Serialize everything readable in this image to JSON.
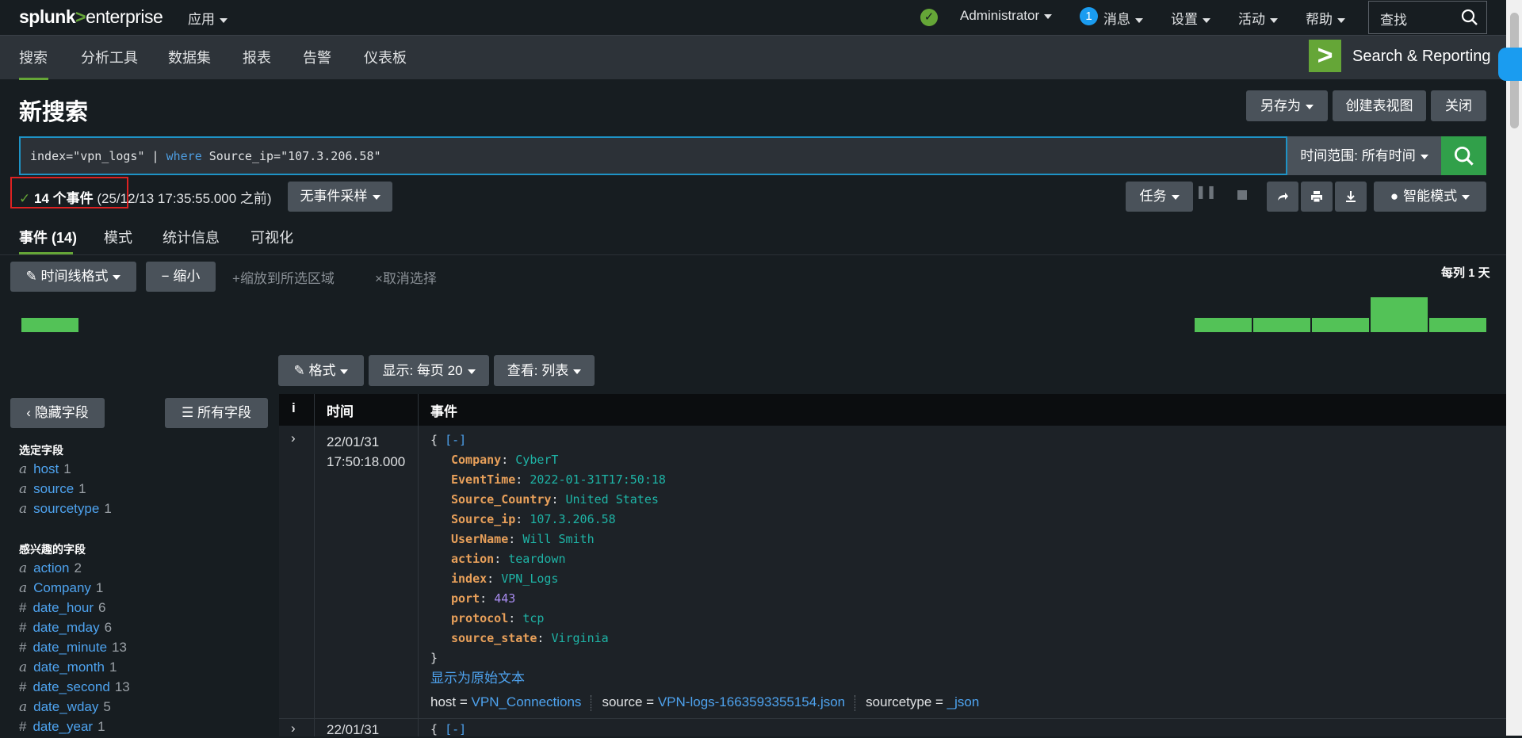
{
  "topbar": {
    "logo": {
      "splunk": "splunk",
      "gt": ">",
      "product": "enterprise"
    },
    "apps_label": "应用",
    "user_label": "Administrator",
    "messages_count": "1",
    "messages_label": "消息",
    "settings_label": "设置",
    "activity_label": "活动",
    "help_label": "帮助",
    "find_label": "查找"
  },
  "appnav": {
    "items": [
      "搜索",
      "分析工具",
      "数据集",
      "报表",
      "告警",
      "仪表板"
    ],
    "app_name": "Search & Reporting",
    "app_logo": ">"
  },
  "page": {
    "title": "新搜索",
    "save_as": "另存为",
    "create_table": "创建表视图",
    "close": "关闭"
  },
  "search": {
    "query_prefix": "index=\"vpn_logs\" | ",
    "query_keyword": "where",
    "query_suffix": " Source_ip=\"107.3.206.58\"",
    "time_range": "时间范围: 所有时间"
  },
  "status": {
    "check": "✓",
    "count_text": "14 个事件",
    "time_text": "(25/12/13 17:35:55.000 之前)",
    "sampling": "无事件采样",
    "job": "任务",
    "smart_mode": "智能模式"
  },
  "tabs": [
    "事件 (14)",
    "模式",
    "统计信息",
    "可视化"
  ],
  "timeline": {
    "format_label": "时间线格式",
    "zoom_out": "缩小",
    "zoom_selection": "缩放到所选区域",
    "deselect": "取消选择",
    "per_column": "每列 1 天",
    "bar_levels": [
      1,
      1,
      1,
      1,
      2,
      1
    ]
  },
  "results_toolbar": {
    "format": "格式",
    "show": "显示: 每页 20",
    "view": "查看: 列表"
  },
  "fields": {
    "hide_label": "隐藏字段",
    "all_label": "所有字段",
    "selected_heading": "选定字段",
    "selected": [
      {
        "type": "a",
        "name": "host",
        "count": "1"
      },
      {
        "type": "a",
        "name": "source",
        "count": "1"
      },
      {
        "type": "a",
        "name": "sourcetype",
        "count": "1"
      }
    ],
    "interesting_heading": "感兴趣的字段",
    "interesting": [
      {
        "type": "a",
        "name": "action",
        "count": "2"
      },
      {
        "type": "a",
        "name": "Company",
        "count": "1"
      },
      {
        "type": "#",
        "name": "date_hour",
        "count": "6"
      },
      {
        "type": "#",
        "name": "date_mday",
        "count": "6"
      },
      {
        "type": "#",
        "name": "date_minute",
        "count": "13"
      },
      {
        "type": "a",
        "name": "date_month",
        "count": "1"
      },
      {
        "type": "#",
        "name": "date_second",
        "count": "13"
      },
      {
        "type": "a",
        "name": "date_wday",
        "count": "5"
      },
      {
        "type": "#",
        "name": "date_year",
        "count": "1"
      }
    ]
  },
  "table": {
    "col_info": "i",
    "col_time": "时间",
    "col_event": "事件",
    "events": [
      {
        "date": "22/01/31",
        "time": "17:50:18.000",
        "open": "{",
        "collapse": "[-]",
        "close": "}",
        "pairs": [
          {
            "key": "Company",
            "value": "CyberT",
            "num": false
          },
          {
            "key": "EventTime",
            "value": "2022-01-31T17:50:18",
            "num": false
          },
          {
            "key": "Source_Country",
            "value": "United States",
            "num": false
          },
          {
            "key": "Source_ip",
            "value": "107.3.206.58",
            "num": false
          },
          {
            "key": "UserName",
            "value": "Will Smith",
            "num": false
          },
          {
            "key": "action",
            "value": "teardown",
            "num": false
          },
          {
            "key": "index",
            "value": "VPN_Logs",
            "num": false
          },
          {
            "key": "port",
            "value": "443",
            "num": true
          },
          {
            "key": "protocol",
            "value": "tcp",
            "num": false
          },
          {
            "key": "source_state",
            "value": "Virginia",
            "num": false
          }
        ],
        "show_raw": "显示为原始文本",
        "meta": [
          {
            "label": "host = ",
            "value": "VPN_Connections"
          },
          {
            "label": "source = ",
            "value": "VPN-logs-1663593355154.json"
          },
          {
            "label": "sourcetype = ",
            "value": "_json"
          }
        ]
      },
      {
        "date": "22/01/31",
        "open": "{",
        "collapse": "[-]"
      }
    ]
  },
  "colors": {
    "accent_green": "#65a637",
    "link_blue": "#4ea3ef",
    "json_key": "#e8a05a",
    "json_value": "#1eb4a6",
    "search_border": "#1e93c6",
    "highlight_red": "#dd2222"
  }
}
